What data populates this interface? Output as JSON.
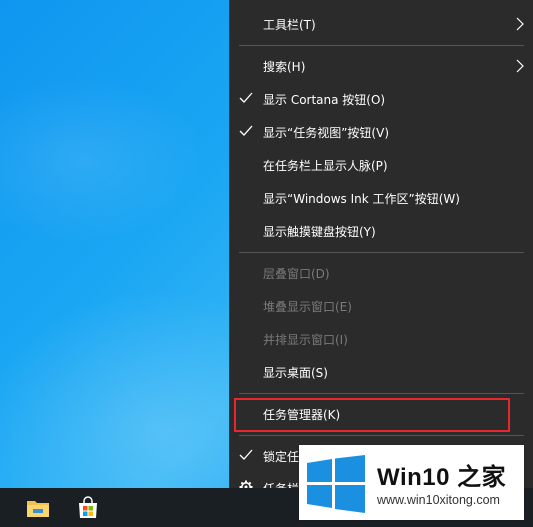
{
  "menu": {
    "items": [
      {
        "label": "工具栏(T)",
        "checked": false,
        "submenu": true,
        "disabled": false
      },
      {
        "label": "搜索(H)",
        "checked": false,
        "submenu": true,
        "disabled": false
      },
      {
        "label": "显示 Cortana 按钮(O)",
        "checked": true,
        "submenu": false,
        "disabled": false
      },
      {
        "label": "显示“任务视图”按钮(V)",
        "checked": true,
        "submenu": false,
        "disabled": false
      },
      {
        "label": "在任务栏上显示人脉(P)",
        "checked": false,
        "submenu": false,
        "disabled": false
      },
      {
        "label": "显示“Windows Ink 工作区”按钮(W)",
        "checked": false,
        "submenu": false,
        "disabled": false
      },
      {
        "label": "显示触摸键盘按钮(Y)",
        "checked": false,
        "submenu": false,
        "disabled": false
      },
      {
        "label": "层叠窗口(D)",
        "checked": false,
        "submenu": false,
        "disabled": true
      },
      {
        "label": "堆叠显示窗口(E)",
        "checked": false,
        "submenu": false,
        "disabled": true
      },
      {
        "label": "并排显示窗口(I)",
        "checked": false,
        "submenu": false,
        "disabled": true
      },
      {
        "label": "显示桌面(S)",
        "checked": false,
        "submenu": false,
        "disabled": false
      },
      {
        "label": "任务管理器(K)",
        "checked": false,
        "submenu": false,
        "disabled": false,
        "highlighted": true
      },
      {
        "label": "锁定任",
        "checked": true,
        "submenu": false,
        "disabled": false
      },
      {
        "label": "任务栏",
        "checked": false,
        "submenu": false,
        "disabled": false,
        "icon": "gear-icon"
      }
    ]
  },
  "taskbar": {
    "icons": [
      "file-explorer-icon",
      "microsoft-store-icon"
    ]
  },
  "watermark": {
    "title": "Win10 之家",
    "url": "www.win10xitong.com"
  },
  "colors": {
    "menu_bg": "#2b2b2b",
    "highlight_border": "#e8262b",
    "desktop_blue": "#1aa6f3",
    "taskbar": "#1a1f24"
  }
}
